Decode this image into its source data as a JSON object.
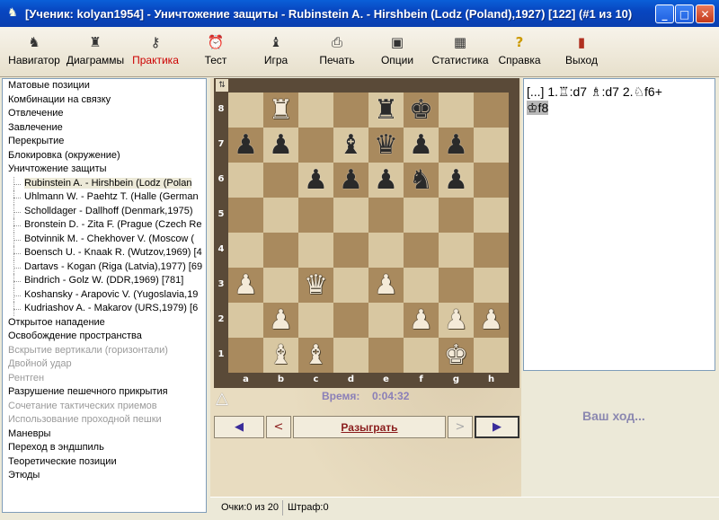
{
  "window": {
    "title": "[Ученик: kolyan1954]  - Уничтожение защиты - Rubinstein A.  - Hirshbein (Lodz (Poland),1927) [122] (#1 из 10)",
    "minimize": "_",
    "maximize": "□",
    "close": "✕"
  },
  "toolbar": [
    {
      "label": "Навигатор",
      "icon": "♞"
    },
    {
      "label": "Диаграммы",
      "icon": "♜"
    },
    {
      "label": "Практика",
      "icon": "⚷",
      "active": true
    },
    {
      "label": "Тест",
      "icon": "⏰"
    },
    {
      "label": "Игра",
      "icon": "♝"
    },
    {
      "label": "Печать",
      "icon": "⎙"
    },
    {
      "label": "Опции",
      "icon": "▣"
    },
    {
      "label": "Статистика",
      "icon": "▦"
    },
    {
      "label": "Справка",
      "icon": "?"
    },
    {
      "label": "Выход",
      "icon": "▮"
    }
  ],
  "topics": [
    {
      "label": "Матовые позиции"
    },
    {
      "label": "Комбинации на связку"
    },
    {
      "label": "Отвлечение"
    },
    {
      "label": "Завлечение"
    },
    {
      "label": "Перекрытие"
    },
    {
      "label": "Блокировка (окружение)"
    },
    {
      "label": "Уничтожение защиты"
    },
    {
      "label": "Rubinstein A. - Hirshbein (Lodz (Polan",
      "sub": true,
      "selected": true
    },
    {
      "label": "Uhlmann W. - Paehtz T. (Halle (German",
      "sub": true
    },
    {
      "label": "Scholldager - Dallhoff (Denmark,1975)",
      "sub": true
    },
    {
      "label": "Bronstein D. - Zita F. (Prague (Czech Re",
      "sub": true
    },
    {
      "label": "Botvinnik M. - Chekhover V. (Moscow (",
      "sub": true
    },
    {
      "label": "Boensch U. - Knaak R. (Wutzov,1969) [4",
      "sub": true
    },
    {
      "label": "Dartavs - Kogan (Riga (Latvia),1977) [69",
      "sub": true
    },
    {
      "label": "Bindrich - Golz W. (DDR,1969) [781]",
      "sub": true
    },
    {
      "label": "Koshansky - Arapovic V. (Yugoslavia,19",
      "sub": true
    },
    {
      "label": "Kudriashov A. - Makarov  (URS,1979) [6",
      "sub": true
    },
    {
      "label": "Открытое нападение"
    },
    {
      "label": "Освобождение пространства"
    },
    {
      "label": "Вскрытие вертикали (горизонтали)",
      "disabled": true
    },
    {
      "label": "Двойной удар",
      "disabled": true
    },
    {
      "label": "Рентген",
      "disabled": true
    },
    {
      "label": "Разрушение пешечного прикрытия"
    },
    {
      "label": "Сочетание тактических приемов",
      "disabled": true
    },
    {
      "label": "Использование проходной пешки",
      "disabled": true
    },
    {
      "label": "Маневры"
    },
    {
      "label": "Переход в эндшпиль"
    },
    {
      "label": "Теоретические позиции"
    },
    {
      "label": "Этюды"
    }
  ],
  "board": {
    "flip_icon": "⇅",
    "rank_labels": [
      "8",
      "7",
      "6",
      "5",
      "4",
      "3",
      "2",
      "1"
    ],
    "file_labels": [
      "a",
      "b",
      "c",
      "d",
      "e",
      "f",
      "g",
      "h"
    ],
    "position": [
      [
        "",
        "wR",
        "",
        "",
        "bR",
        "bK",
        "",
        ""
      ],
      [
        "bP",
        "bP",
        "",
        "bB",
        "bQ",
        "bP",
        "bP",
        ""
      ],
      [
        "",
        "",
        "bP",
        "bP",
        "bP",
        "bN",
        "bP",
        ""
      ],
      [
        "",
        "",
        "",
        "",
        "",
        "",
        "",
        ""
      ],
      [
        "",
        "",
        "",
        "",
        "",
        "",
        "",
        ""
      ],
      [
        "wP",
        "",
        "wQ",
        "",
        "wP",
        "",
        "",
        ""
      ],
      [
        "",
        "wP",
        "",
        "",
        "",
        "wP",
        "wP",
        "wP"
      ],
      [
        "",
        "wB",
        "wB",
        "",
        "",
        "",
        "wK",
        ""
      ]
    ]
  },
  "timer": {
    "turn_marker": "△",
    "label": "Время:",
    "value": "0:04:32"
  },
  "nav": {
    "first": "◀",
    "prev": "<",
    "play": "Разыграть",
    "next": ">",
    "last": "▶"
  },
  "notation": {
    "intro": "[...] 1.",
    "move1": "♖:d7 ♗:d7 2.♘f6+",
    "move2": "♔f8"
  },
  "your_move": "Ваш ход...",
  "status": {
    "score": "Очки:0 из 20",
    "penalty": "Штраф:0"
  }
}
